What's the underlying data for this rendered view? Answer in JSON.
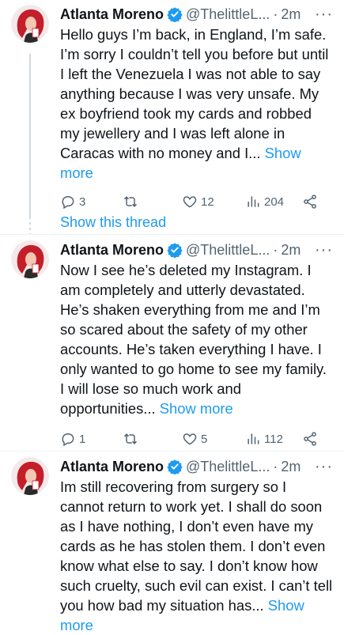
{
  "tweets": [
    {
      "name": "Atlanta Moreno",
      "handle": "@ThelittleL...",
      "dot": "·",
      "time": "2m",
      "text": "Hello guys I’m back, in England, I’m safe. I’m sorry I couldn’t tell you before but until I left the Venezuela I was not able to say anything because I was very unsafe. My ex boyfriend took my cards and robbed my jewellery and I was left alone in Caracas with no money and I...",
      "show_more": "Show more",
      "replies": "3",
      "retweets": "",
      "likes": "12",
      "views": "204"
    },
    {
      "name": "Atlanta Moreno",
      "handle": "@ThelittleL...",
      "dot": "·",
      "time": "2m",
      "text": "Now I see he’s deleted my Instagram. I am completely and utterly devastated. He’s shaken everything from me and I’m so scared about the safety of my other accounts. He’s taken everything I have. I only wanted to go home to see my family. I will lose so much work and opportunities...",
      "show_more": "Show more",
      "replies": "1",
      "retweets": "",
      "likes": "5",
      "views": "112"
    },
    {
      "name": "Atlanta Moreno",
      "handle": "@ThelittleL...",
      "dot": "·",
      "time": "2m",
      "text": "Im still recovering from surgery so I cannot return to work yet. I shall do soon as I have nothing, I don’t even have my cards as he has stolen them. I don’t even know what else to say. I don’t know how such cruelty, such evil can exist. I can’t tell you how bad my situation has...",
      "show_more": "Show more"
    }
  ],
  "show_thread": "Show this thread",
  "more_glyph": "···",
  "colors": {
    "accent": "#1d9bf0",
    "verified": "#1d9bf0",
    "muted": "#536471",
    "text": "#0f1419"
  }
}
